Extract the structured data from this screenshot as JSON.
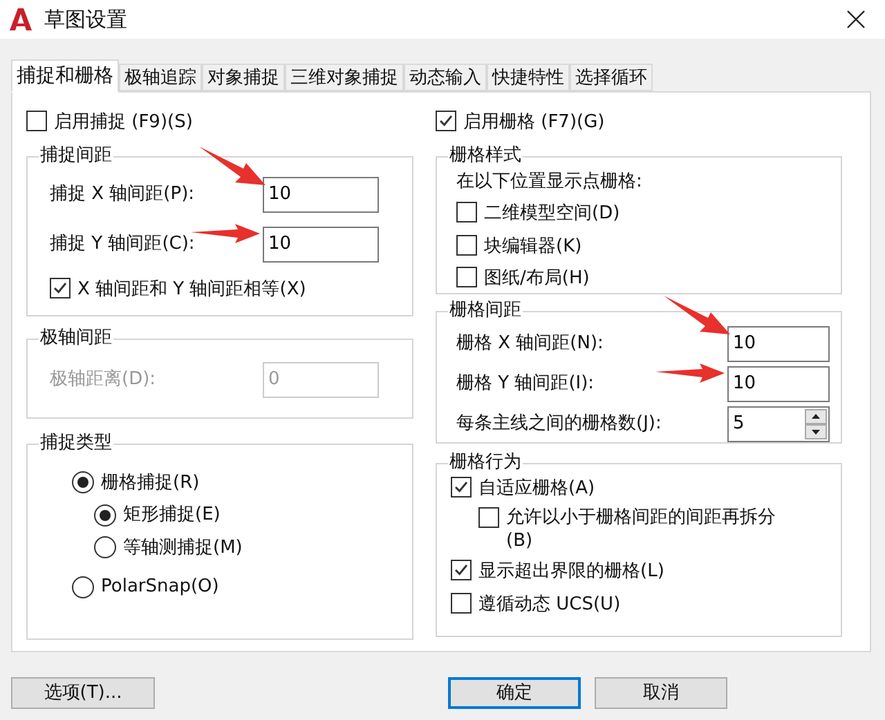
{
  "window": {
    "title": "草图设置"
  },
  "tabs": [
    {
      "label": "捕捉和栅格",
      "selected": true
    },
    {
      "label": "极轴追踪",
      "selected": false
    },
    {
      "label": "对象捕捉",
      "selected": false
    },
    {
      "label": "三维对象捕捉",
      "selected": false
    },
    {
      "label": "动态输入",
      "selected": false
    },
    {
      "label": "快捷特性",
      "selected": false
    },
    {
      "label": "选择循环",
      "selected": false
    }
  ],
  "snap_enabled": {
    "label": "启用捕捉 (F9)(S)",
    "checked": false
  },
  "snap_spacing": {
    "title": "捕捉间距",
    "fields": [
      {
        "label": "捕捉 X 轴间距(P):",
        "value": "10",
        "marked": true
      },
      {
        "label": "捕捉 Y 轴间距(C):",
        "value": "10",
        "marked": true
      }
    ],
    "equal": {
      "label": "X 轴间距和 Y 轴间距相等(X)",
      "checked": true
    }
  },
  "polar_spacing": {
    "title": "极轴间距",
    "field": {
      "label": "极轴距离(D):",
      "value": "0",
      "disabled": true
    }
  },
  "snap_type": {
    "title": "捕捉类型",
    "options": [
      {
        "label": "栅格捕捉(R)",
        "selected": true,
        "children": [
          {
            "label": "矩形捕捉(E)",
            "selected": true
          },
          {
            "label": "等轴测捕捉(M)",
            "selected": false
          }
        ]
      },
      {
        "label": "PolarSnap(O)",
        "selected": false
      }
    ]
  },
  "grid_enabled": {
    "label": "启用栅格 (F7)(G)",
    "checked": true
  },
  "grid_style": {
    "title": "栅格样式",
    "caption": "在以下位置显示点栅格:",
    "options": [
      {
        "label": "二维模型空间(D)",
        "checked": false
      },
      {
        "label": "块编辑器(K)",
        "checked": false
      },
      {
        "label": "图纸/布局(H)",
        "checked": false
      }
    ]
  },
  "grid_spacing": {
    "title": "栅格间距",
    "fields": [
      {
        "label": "栅格 X 轴间距(N):",
        "value": "10",
        "marked": true
      },
      {
        "label": "栅格 Y 轴间距(I):",
        "value": "10",
        "marked": true
      }
    ],
    "major": {
      "label": "每条主线之间的栅格数(J):",
      "value": "5"
    }
  },
  "grid_behavior": {
    "title": "栅格行为",
    "options": [
      {
        "label": "自适应栅格(A)",
        "checked": true,
        "children": [
          {
            "label": "允许以小于栅格间距的间距再拆分(B)",
            "checked": false
          }
        ]
      },
      {
        "label": "显示超出界限的栅格(L)",
        "checked": true
      },
      {
        "label": "遵循动态 UCS(U)",
        "checked": false
      }
    ]
  },
  "buttons": [
    {
      "label": "选项(T)...",
      "default": false
    },
    {
      "label": "确定",
      "default": true
    },
    {
      "label": "取消",
      "default": false
    }
  ]
}
